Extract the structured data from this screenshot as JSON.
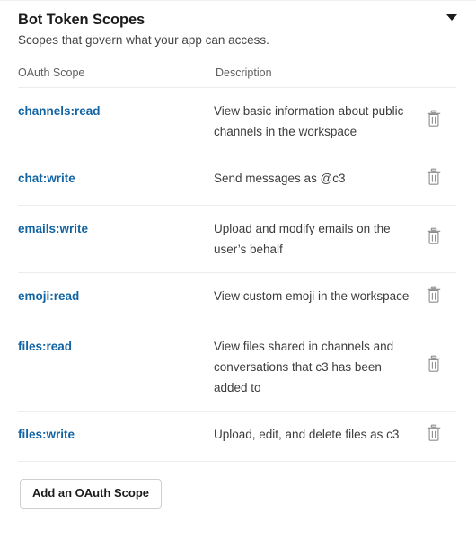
{
  "header": {
    "title": "Bot Token Scopes",
    "subtitle": "Scopes that govern what your app can access.",
    "collapse_icon": "chevron-down-icon"
  },
  "table": {
    "columns": {
      "scope": "OAuth Scope",
      "description": "Description",
      "action": ""
    },
    "delete_icon": "trash-icon",
    "rows": [
      {
        "scope": "channels:read",
        "description": "View basic information about public channels in the workspace"
      },
      {
        "scope": "chat:write",
        "description": "Send messages as @c3"
      },
      {
        "scope": "emails:write",
        "description": "Upload and modify emails on the user’s behalf"
      },
      {
        "scope": "emoji:read",
        "description": "View custom emoji in the workspace"
      },
      {
        "scope": "files:read",
        "description": "View files shared in channels and conversations that c3 has been added to"
      },
      {
        "scope": "files:write",
        "description": "Upload, edit, and delete files as c3"
      }
    ]
  },
  "footer": {
    "add_scope_label": "Add an OAuth Scope"
  },
  "colors": {
    "link": "#1264a3",
    "text": "#1d1c1d",
    "muted": "#616061",
    "divider": "#ededed",
    "icon": "#868686"
  }
}
